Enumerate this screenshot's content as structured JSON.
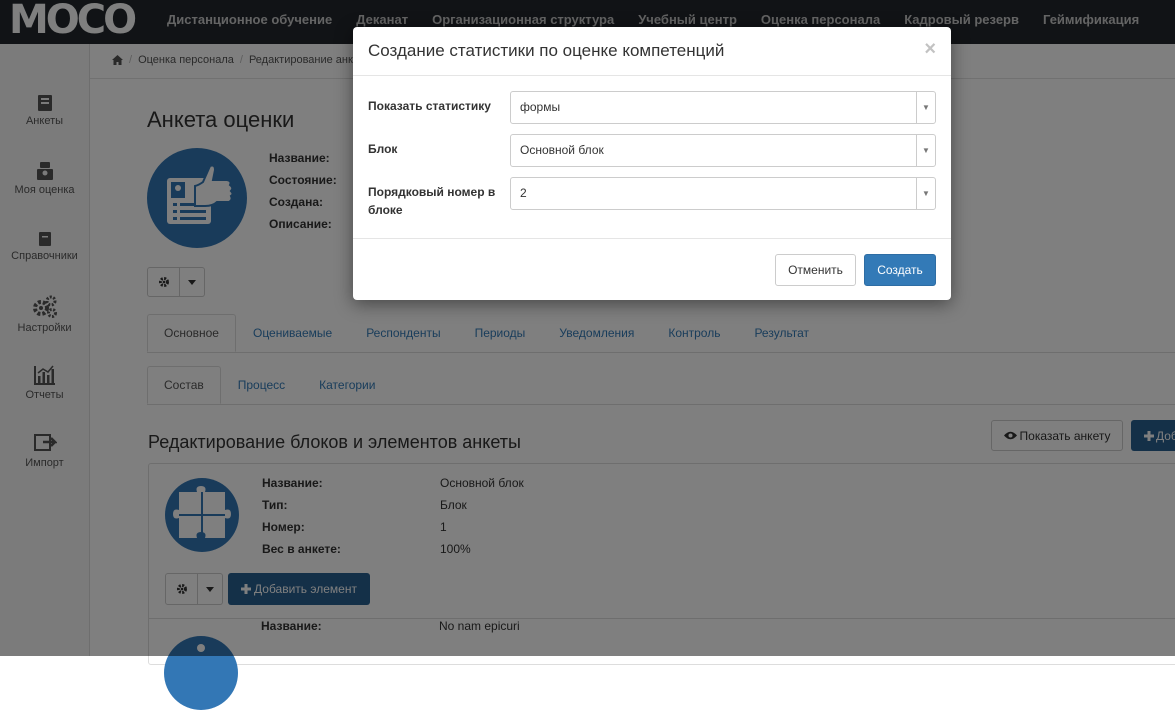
{
  "app": {
    "logo": "MOCO"
  },
  "topnav": [
    {
      "label": "Дистанционное обучение"
    },
    {
      "label": "Деканат"
    },
    {
      "label": "Организационная структура"
    },
    {
      "label": "Учебный центр"
    },
    {
      "label": "Оценка персонала"
    },
    {
      "label": "Кадровый резерв"
    },
    {
      "label": "Геймификация"
    }
  ],
  "sidebar": {
    "items": [
      {
        "label": "Анкеты",
        "icon": "book-icon"
      },
      {
        "label": "Моя оценка",
        "icon": "user-badge-icon"
      },
      {
        "label": "Справочники",
        "icon": "book-closed-icon"
      },
      {
        "label": "Настройки",
        "icon": "gears-icon"
      },
      {
        "label": "Отчеты",
        "icon": "chart-icon"
      },
      {
        "label": "Импорт",
        "icon": "import-icon"
      }
    ]
  },
  "breadcrumb": {
    "home_icon": "home-icon",
    "items": [
      "Оценка персонала",
      "Редактирование анк"
    ]
  },
  "page": {
    "title": "Анкета оценки",
    "meta_labels": [
      "Название:",
      "Состояние:",
      "Создана:",
      "Описание:"
    ]
  },
  "tabs": [
    {
      "label": "Основное",
      "active": true
    },
    {
      "label": "Оцениваемые"
    },
    {
      "label": "Респонденты"
    },
    {
      "label": "Периоды"
    },
    {
      "label": "Уведомления"
    },
    {
      "label": "Контроль"
    },
    {
      "label": "Результат"
    }
  ],
  "subtabs": [
    {
      "label": "Состав",
      "active": true
    },
    {
      "label": "Процесс"
    },
    {
      "label": "Категории"
    }
  ],
  "section": {
    "title": "Редактирование блоков и элементов анкеты",
    "show_button": "Показать анкету",
    "add_button": "Доб"
  },
  "block": {
    "labels": [
      "Название:",
      "Тип:",
      "Номер:",
      "Вес в анкете:"
    ],
    "values": [
      "Основной блок",
      "Блок",
      "1",
      "100%"
    ],
    "add_element": "Добавить элемент"
  },
  "block2": {
    "label": "Название:",
    "value": "No nam epicuri"
  },
  "modal": {
    "title": "Создание статистики по оценке компетенций",
    "close": "×",
    "fields": [
      {
        "label": "Показать статистику",
        "value": "формы"
      },
      {
        "label": "Блок",
        "value": "Основной блок"
      },
      {
        "label": "Порядковый номер в блоке",
        "value": "2"
      }
    ],
    "cancel": "Отменить",
    "create": "Создать"
  },
  "colors": {
    "primary": "#337ab7",
    "topbar": "#22272d",
    "accent_blue": "#3377b5"
  }
}
